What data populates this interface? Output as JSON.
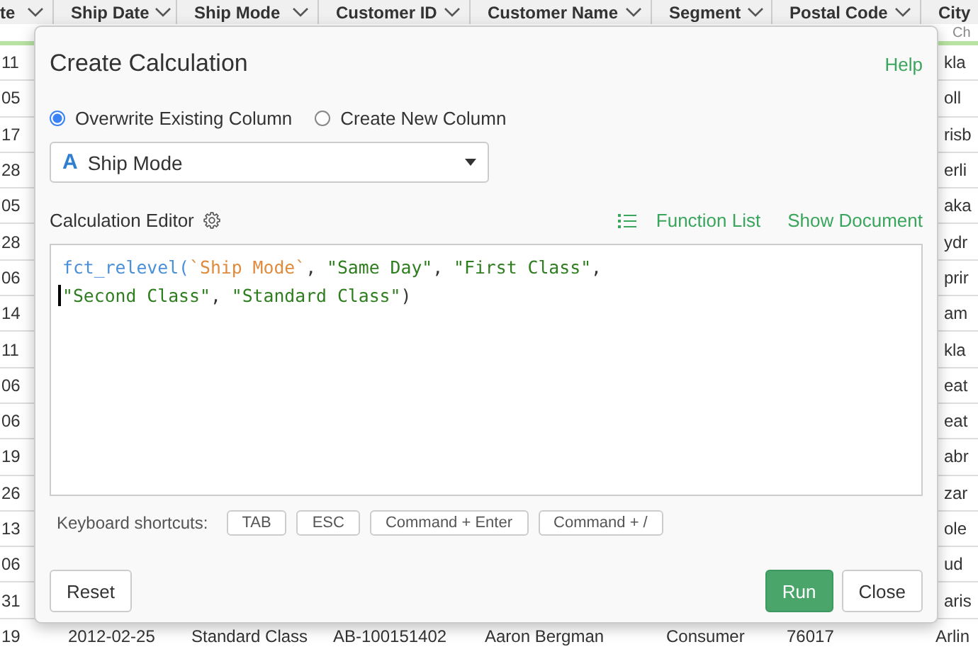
{
  "table": {
    "columns": [
      {
        "label": "te"
      },
      {
        "label": "Ship Date"
      },
      {
        "label": "Ship Mode"
      },
      {
        "label": "Customer ID"
      },
      {
        "label": "Customer Name"
      },
      {
        "label": "Segment"
      },
      {
        "label": "Postal Code"
      },
      {
        "label": "City"
      }
    ],
    "subheader": "Ch",
    "rows": [
      [
        "11",
        "kla"
      ],
      [
        "05",
        "oll"
      ],
      [
        "17",
        "risb"
      ],
      [
        "28",
        "erli"
      ],
      [
        "05",
        "aka"
      ],
      [
        "28",
        "ydr"
      ],
      [
        "06",
        "prir"
      ],
      [
        "14",
        "am"
      ],
      [
        "11",
        "kla"
      ],
      [
        "06",
        "eat"
      ],
      [
        "06",
        "eat"
      ],
      [
        "19",
        "abr"
      ],
      [
        "26",
        "zar"
      ],
      [
        "13",
        "ole"
      ],
      [
        "06",
        "ud"
      ],
      [
        "31",
        "aris"
      ]
    ],
    "last_row": [
      "19",
      "2012-02-25",
      "Standard Class",
      "AB-100151402",
      "Aaron Bergman",
      "Consumer",
      "76017",
      "Arlin"
    ]
  },
  "dialog": {
    "title": "Create Calculation",
    "help": "Help",
    "options": [
      {
        "label": "Overwrite Existing Column",
        "selected": true
      },
      {
        "label": "Create New Column",
        "selected": false
      }
    ],
    "column_select": {
      "type_icon": "A",
      "value": "Ship Mode"
    },
    "editor_label": "Calculation Editor",
    "function_list": "Function List",
    "show_document": "Show Document",
    "code_lines": [
      {
        "cursor": false,
        "tokens": [
          {
            "kind": "function",
            "text": "fct_relevel("
          },
          {
            "kind": "column",
            "text": "`Ship Mode`"
          },
          {
            "kind": "plain",
            "text": ", "
          },
          {
            "kind": "string",
            "text": "\"Same Day\""
          },
          {
            "kind": "plain",
            "text": ", "
          },
          {
            "kind": "string",
            "text": "\"First Class\""
          },
          {
            "kind": "plain",
            "text": ","
          }
        ]
      },
      {
        "cursor": true,
        "tokens": [
          {
            "kind": "string",
            "text": "\"Second Class\""
          },
          {
            "kind": "plain",
            "text": ", "
          },
          {
            "kind": "string",
            "text": "\"Standard Class\""
          },
          {
            "kind": "plain",
            "text": ")"
          }
        ]
      }
    ],
    "shortcuts_label": "Keyboard shortcuts:",
    "shortcuts": [
      "TAB",
      "ESC",
      "Command + Enter",
      "Command + /"
    ],
    "buttons": {
      "reset": "Reset",
      "run": "Run",
      "close": "Close"
    }
  }
}
